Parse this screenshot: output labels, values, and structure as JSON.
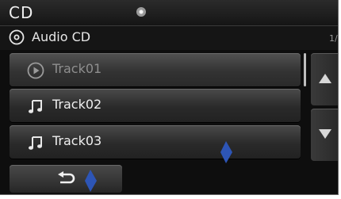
{
  "header": {
    "title": "CD"
  },
  "source": {
    "icon": "disc-icon",
    "label": "Audio CD",
    "page_indicator": "1/"
  },
  "tracks": [
    {
      "label": "Track01",
      "icon": "play-circle-icon",
      "state": "playing"
    },
    {
      "label": "Track02",
      "icon": "music-note-icon",
      "state": "idle"
    },
    {
      "label": "Track03",
      "icon": "music-note-icon",
      "state": "idle"
    }
  ],
  "controls": {
    "scroll_up_icon": "triangle-up-icon",
    "scroll_down_icon": "triangle-down-icon",
    "back_icon": "back-arrow-icon"
  },
  "colors": {
    "background": "#0e0e0e",
    "button": "#333333",
    "text": "#f0f0f0",
    "dimmed_text": "#8f8f8f"
  }
}
